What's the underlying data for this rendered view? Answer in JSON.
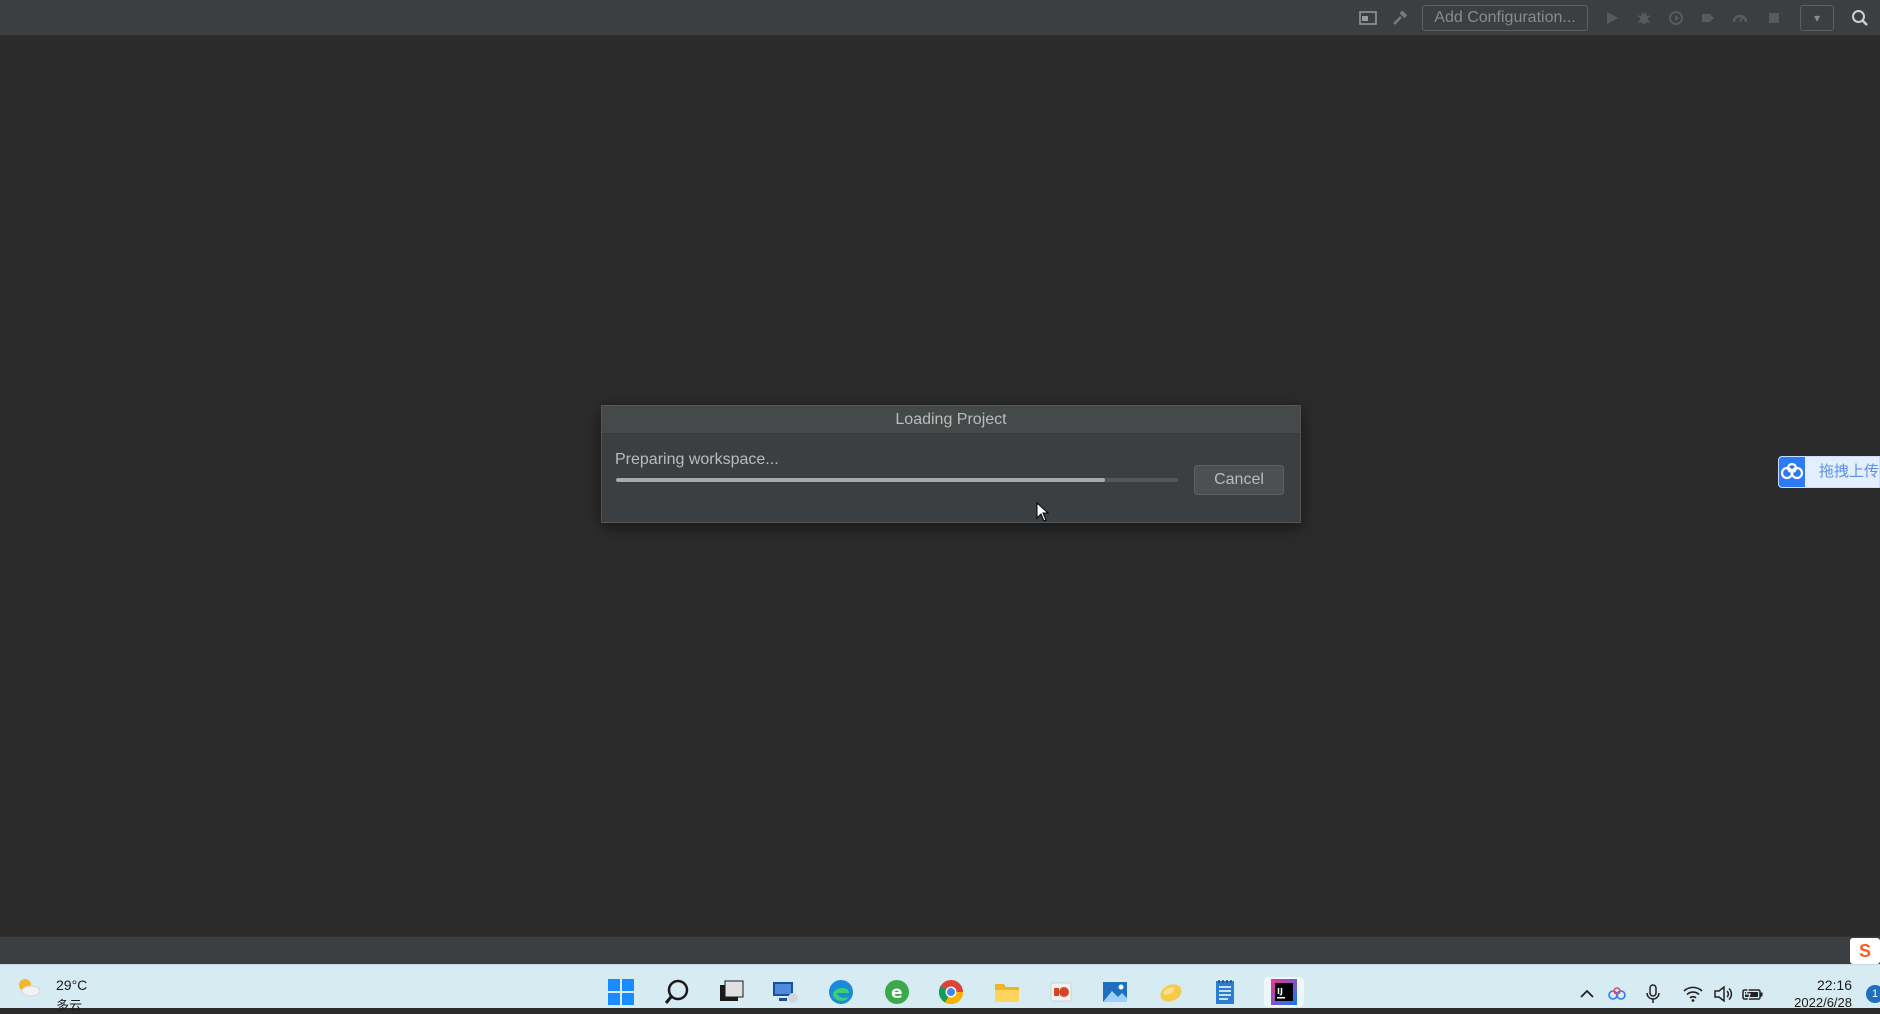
{
  "toolbar": {
    "add_configuration_label": "Add Configuration...",
    "icons": [
      "layout-icon",
      "build-hammer-icon",
      "run-icon",
      "debug-icon",
      "coverage-icon",
      "profile-icon",
      "attach-icon",
      "stop-icon",
      "dropdown-icon",
      "search-icon"
    ]
  },
  "dialog": {
    "title": "Loading Project",
    "message": "Preparing workspace...",
    "progress_fraction": 0.87,
    "cancel_label": "Cancel"
  },
  "baidu_widget": {
    "text": "拖拽上传"
  },
  "taskbar": {
    "weather": {
      "temperature": "29°C",
      "condition": "多云"
    },
    "apps": [
      "windows-start",
      "search",
      "task-view",
      "remote-desktop",
      "edge",
      "ie-edge",
      "chrome",
      "file-explorer",
      "powerpoint",
      "photos",
      "unknown-app",
      "notepad",
      "intellij-idea"
    ],
    "clock": {
      "time": "22:16",
      "date": "2022/6/28"
    },
    "notification_count": "1"
  },
  "colors": {
    "ide_background": "#2b2b2b",
    "toolbar_background": "#3c3f41",
    "taskbar_background": "#d7ebf3",
    "accent_blue": "#2c7af5"
  }
}
